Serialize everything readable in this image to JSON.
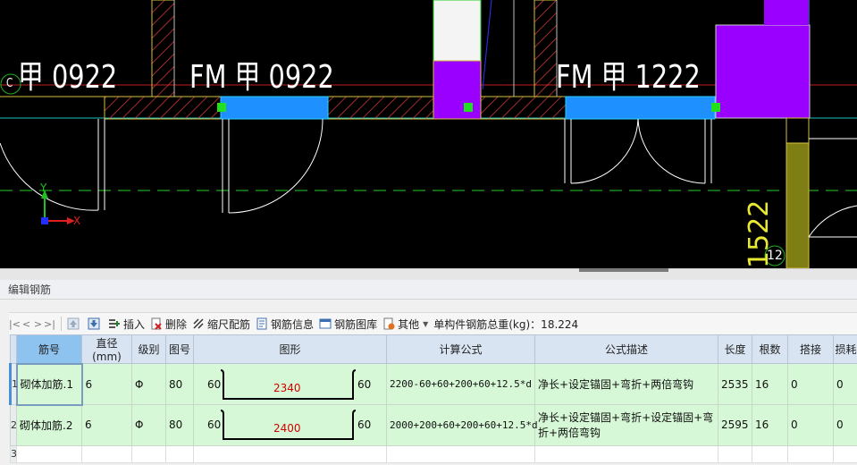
{
  "cad": {
    "labels": {
      "door_left": "甲 0922",
      "door_mid": "FM 甲 0922",
      "door_right": "FM 甲 1222",
      "grid_c": "C",
      "grid_12": "12",
      "vertical_text": "1522",
      "axis_x": "X",
      "axis_y": "Y"
    }
  },
  "panel": {
    "title": "编辑钢筋",
    "toolbar": {
      "insert": "插入",
      "delete": "删除",
      "scale_rebar": "缩尺配筋",
      "rebar_info": "钢筋信息",
      "rebar_library": "钢筋图库",
      "other": "其他",
      "total_weight": "单构件钢筋总重(kg)：18.224"
    }
  },
  "grid": {
    "columns": [
      "筋号",
      "直径(mm)",
      "级别",
      "图号",
      "图形",
      "计算公式",
      "公式描述",
      "长度",
      "根数",
      "搭接",
      "损耗"
    ],
    "rows": [
      {
        "num": "1",
        "name": "砌体加筋.1",
        "diameter": "6",
        "grade": "Φ",
        "figure_no": "80",
        "shape_left": "60",
        "shape_mid": "2340",
        "shape_right": "60",
        "formula": "2200-60+60+200+60+12.5*d",
        "description": "净长+设定锚固+弯折+两倍弯钩",
        "length": "2535",
        "count": "16",
        "lap": "0",
        "loss": "0"
      },
      {
        "num": "2",
        "name": "砌体加筋.2",
        "diameter": "6",
        "grade": "Φ",
        "figure_no": "80",
        "shape_left": "60",
        "shape_mid": "2400",
        "shape_right": "60",
        "formula": "2000+200+60+200+60+12.5*d",
        "description": "净长+设定锚固+弯折+设定锚固+弯折+两倍弯钩",
        "length": "2595",
        "count": "16",
        "lap": "0",
        "loss": "0"
      }
    ],
    "empty_row_num": "3"
  },
  "colors": {
    "cad_bg": "#000000",
    "wall_fill": "#1e90ff",
    "hatch": "#d83a3a",
    "column_purple": "#9900ff",
    "olive": "#8a8a1a",
    "grid_row": "#d6f8d6",
    "header": "#d9e4f2"
  }
}
